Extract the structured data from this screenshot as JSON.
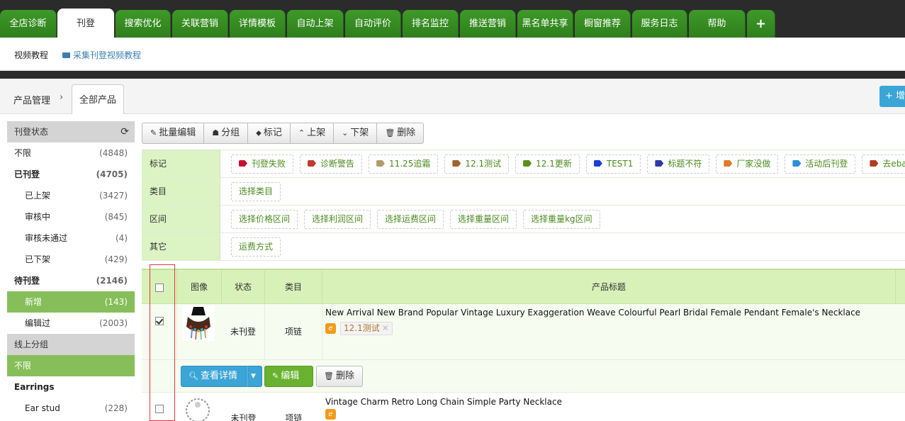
{
  "top_tabs": [
    {
      "label": "全店诊断",
      "active": false
    },
    {
      "label": "刊登",
      "active": true
    },
    {
      "label": "搜索优化",
      "active": false
    },
    {
      "label": "关联营销",
      "active": false
    },
    {
      "label": "详情模板",
      "active": false
    },
    {
      "label": "自动上架",
      "active": false
    },
    {
      "label": "自动评价",
      "active": false
    },
    {
      "label": "排名监控",
      "active": false
    },
    {
      "label": "推送营销",
      "active": false
    },
    {
      "label": "黑名单共享",
      "active": false
    },
    {
      "label": "橱窗推荐",
      "active": false
    },
    {
      "label": "服务日志",
      "active": false
    },
    {
      "label": "帮助",
      "active": false
    },
    {
      "label": "+",
      "active": false
    }
  ],
  "subbar": {
    "link1": "视频教程",
    "link2": "采集刊登视频教程"
  },
  "breadcrumb": {
    "root": "产品管理",
    "arrow": "›",
    "current": "全部产品",
    "add_button": "+ 增加"
  },
  "sidebar": {
    "status_header": "刊登状态",
    "status_items": [
      {
        "label": "不限",
        "count": "(4848)",
        "level": "top",
        "bold": false,
        "active": false
      },
      {
        "label": "已刊登",
        "count": "(4705)",
        "level": "top",
        "bold": true,
        "active": false
      },
      {
        "label": "已上架",
        "count": "(3427)",
        "level": "sub",
        "bold": false,
        "active": false
      },
      {
        "label": "审核中",
        "count": "(845)",
        "level": "sub",
        "bold": false,
        "active": false
      },
      {
        "label": "审核未通过",
        "count": "(4)",
        "level": "sub",
        "bold": false,
        "active": false
      },
      {
        "label": "已下架",
        "count": "(429)",
        "level": "sub",
        "bold": false,
        "active": false
      },
      {
        "label": "待刊登",
        "count": "(2146)",
        "level": "top",
        "bold": true,
        "active": false
      },
      {
        "label": "新增",
        "count": "(143)",
        "level": "sub",
        "bold": false,
        "active": true
      },
      {
        "label": "编辑过",
        "count": "(2003)",
        "level": "sub",
        "bold": false,
        "active": false
      }
    ],
    "group_header": "线上分组",
    "group_items": [
      {
        "label": "不限",
        "count": "",
        "level": "top",
        "bold": false,
        "active": true
      },
      {
        "label": "Earrings",
        "count": "",
        "level": "top",
        "bold": true,
        "active": false
      },
      {
        "label": "Ear stud",
        "count": "(228)",
        "level": "sub",
        "bold": false,
        "active": false
      }
    ]
  },
  "toolbar": [
    {
      "icon": "✎",
      "label": "批量编辑",
      "name": "batch-edit-button"
    },
    {
      "icon": "☗",
      "label": "分组",
      "name": "group-button"
    },
    {
      "icon": "⬥",
      "label": "标记",
      "name": "mark-button"
    },
    {
      "icon": "⌃",
      "label": "上架",
      "name": "list-up-button"
    },
    {
      "icon": "⌄",
      "label": "下架",
      "name": "list-down-button"
    },
    {
      "icon": "🗑",
      "label": "删除",
      "name": "delete-button"
    }
  ],
  "filters": [
    {
      "label": "标记",
      "options": [
        {
          "text": "刊登失败",
          "color": "#c8102e"
        },
        {
          "text": "诊断警告",
          "color": "#c0392b"
        },
        {
          "text": "11.25追霜",
          "color": "#b49a6a"
        },
        {
          "text": "12.1测试",
          "color": "#a0622d"
        },
        {
          "text": "12.1更新",
          "color": "#5a8f1d"
        },
        {
          "text": "TEST1",
          "color": "#1a3fd6"
        },
        {
          "text": "标题不符",
          "color": "#2c3aa8"
        },
        {
          "text": "厂家没做",
          "color": "#e07a2a"
        },
        {
          "text": "活动后刊登",
          "color": "#2b8fd8"
        },
        {
          "text": "去ebay",
          "color": "#b23a1e"
        }
      ]
    },
    {
      "label": "类目",
      "options": [
        {
          "text": "选择类目",
          "color": ""
        }
      ]
    },
    {
      "label": "区间",
      "options": [
        {
          "text": "选择价格区间",
          "color": ""
        },
        {
          "text": "选择利润区间",
          "color": ""
        },
        {
          "text": "选择运费区间",
          "color": ""
        },
        {
          "text": "选择重量区间",
          "color": ""
        },
        {
          "text": "选择重量kg区间",
          "color": ""
        }
      ]
    },
    {
      "label": "其它",
      "options": [
        {
          "text": "运费方式",
          "color": ""
        }
      ]
    }
  ],
  "table": {
    "headers": {
      "image": "图像",
      "status": "状态",
      "category": "类目",
      "title": "产品标题"
    },
    "rows": [
      {
        "checked": true,
        "status": "未刊登",
        "category": "项链",
        "title": "New Arrival New Brand Popular Vintage Luxury Exaggeration Weave Colourful Pearl Bridal Female Pendant Female's Necklace",
        "tag": "12.1测试"
      },
      {
        "checked": false,
        "status": "未刊登",
        "category": "项链",
        "title": "Vintage Charm Retro Long Chain Simple Party Necklace",
        "tag": ""
      }
    ],
    "actions": {
      "view": "查看详情",
      "edit": "编辑",
      "delete": "删除"
    }
  }
}
